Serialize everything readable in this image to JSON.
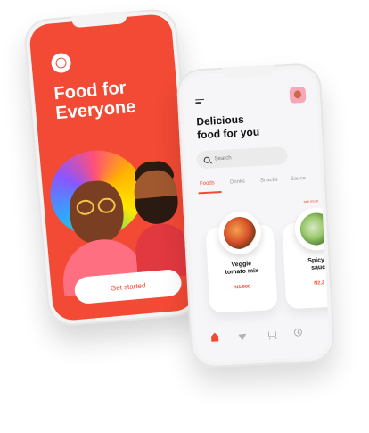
{
  "onboarding": {
    "title_line1": "Food for",
    "title_line2": "Everyone",
    "cta_label": "Get started"
  },
  "home": {
    "title_line1": "Delicious",
    "title_line2": "food for you",
    "search_placeholder": "Search",
    "tabs": [
      {
        "label": "Foods",
        "active": true
      },
      {
        "label": "Drinks",
        "active": false
      },
      {
        "label": "Snacks",
        "active": false
      },
      {
        "label": "Sauce",
        "active": false
      }
    ],
    "see_more_label": "see more",
    "cards": [
      {
        "name_line1": "Veggie",
        "name_line2": "tomato mix",
        "price": "N1,900"
      },
      {
        "name_line1": "Spicy f",
        "name_line2": "sauc",
        "price": "N2,3"
      }
    ]
  },
  "colors": {
    "brand_red": "#f24a35",
    "background": "#ffffff",
    "screen_light": "#f6f6f8"
  },
  "icons": {
    "logo": "chef-hat-icon",
    "menu": "hamburger-menu-icon",
    "search": "search-icon",
    "nav": [
      "home-icon",
      "send-icon",
      "cart-icon",
      "clock-icon"
    ]
  }
}
